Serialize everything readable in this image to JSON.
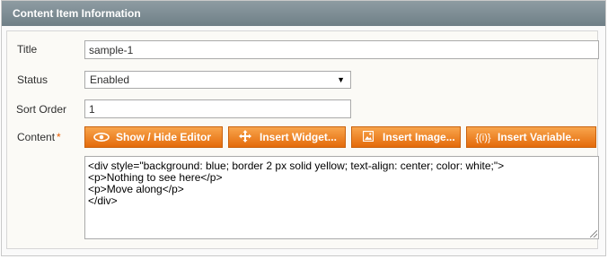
{
  "panel": {
    "title": "Content Item Information"
  },
  "form": {
    "title_label": "Title",
    "title_value": "sample-1",
    "status_label": "Status",
    "status_value": "Enabled",
    "sort_order_label": "Sort Order",
    "sort_order_value": "1",
    "content_label": "Content",
    "required_marker": "*"
  },
  "buttons": {
    "show_hide_editor": "Show / Hide Editor",
    "insert_widget": "Insert Widget...",
    "insert_image": "Insert Image...",
    "insert_variable": "Insert Variable..."
  },
  "icons": {
    "show_hide_editor": "eye-icon",
    "insert_widget": "widget-move-icon",
    "insert_image": "image-icon",
    "insert_variable": "variable-braces-icon"
  },
  "content_value": "<div style=\"background: blue; border 2 px solid yellow; text-align: center; color: white;\">\n<p>Nothing to see here</p>\n<p>Move along</p>\n</div>",
  "colors": {
    "header_bg": "#7a8a92",
    "button_bg": "#eb7a1c",
    "required": "#eb5e00"
  }
}
